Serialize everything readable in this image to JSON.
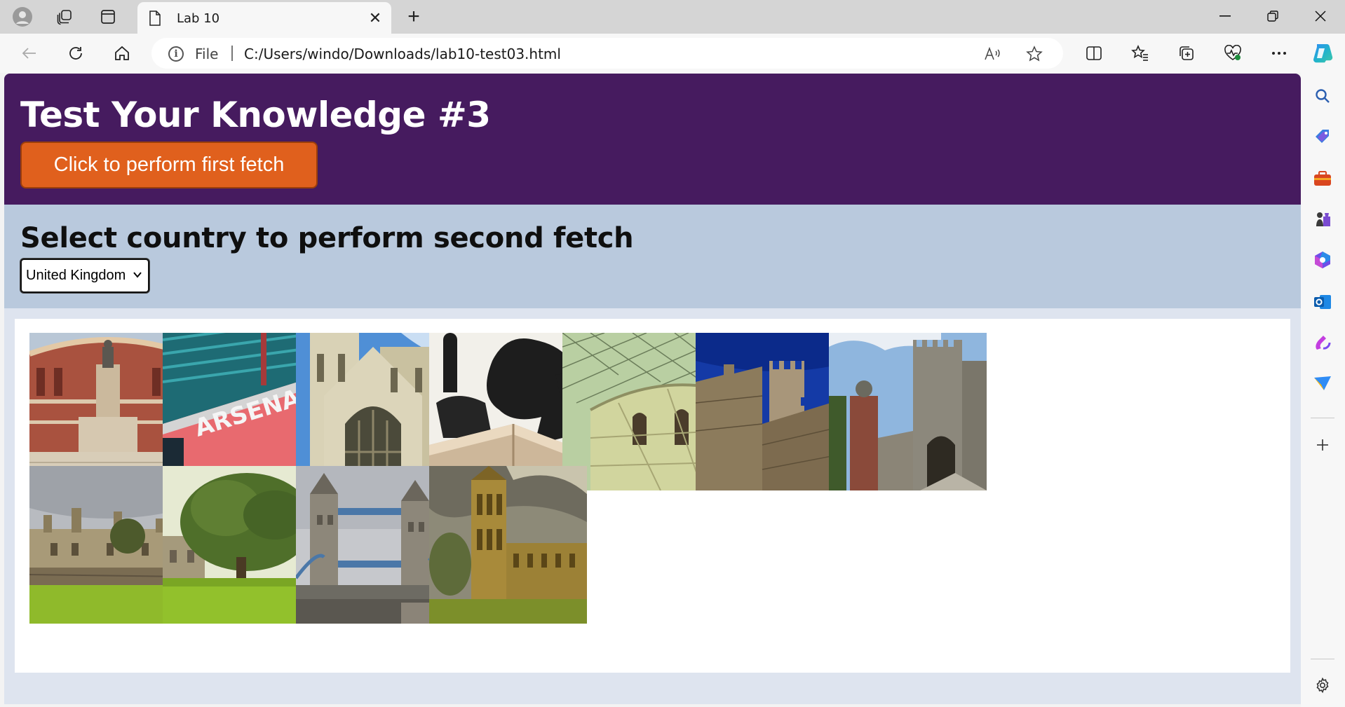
{
  "browser": {
    "tab_title": "Lab 10",
    "address_scheme": "File",
    "address_url": "C:/Users/windo/Downloads/lab10-test03.html"
  },
  "page": {
    "heading": "Test Your Knowledge #3",
    "fetch_button_label": "Click to perform first fetch",
    "country_heading": "Select country to perform second fetch",
    "country_select_value": "United Kingdom"
  },
  "gallery": {
    "images": [
      {
        "subject": "royal-albert-hall"
      },
      {
        "subject": "arsenal-stadium"
      },
      {
        "subject": "westminster-abbey"
      },
      {
        "subject": "boadicea-statue"
      },
      {
        "subject": "british-museum-great-court"
      },
      {
        "subject": "castle-battlements"
      },
      {
        "subject": "castle-tower-gate"
      },
      {
        "subject": "oxford-college"
      },
      {
        "subject": "great-oak-tree"
      },
      {
        "subject": "tower-bridge"
      },
      {
        "subject": "palace-of-westminster"
      }
    ]
  },
  "colors": {
    "header_bg": "#461b5f",
    "button_bg": "#e0601d",
    "country_panel_bg": "#b9c9dd"
  }
}
